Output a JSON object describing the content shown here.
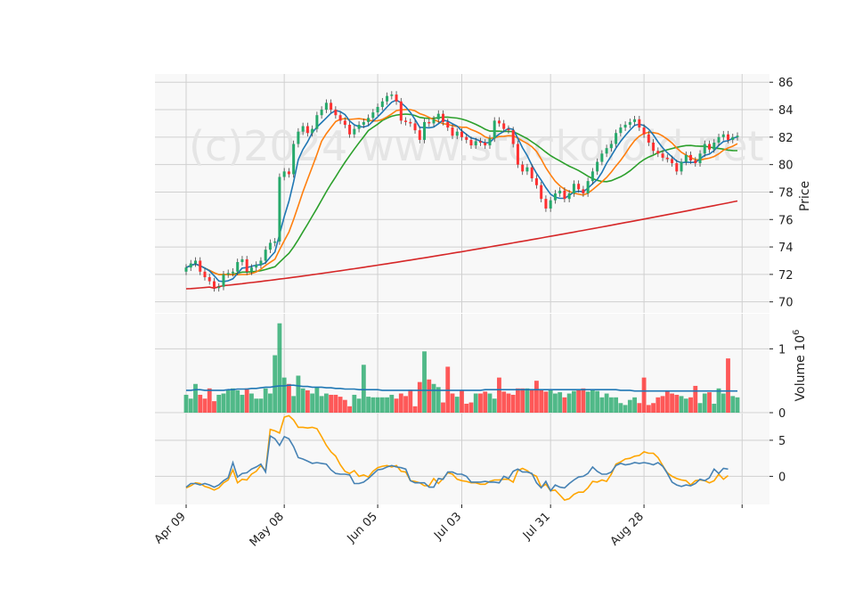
{
  "watermark": "(c)2024 www.stockdroid.net",
  "chart_data": [
    {
      "type": "candlestick",
      "panel": "price",
      "ylabel": "Price",
      "ylim": [
        69.2,
        86.6
      ],
      "yticks": [
        70,
        72,
        74,
        76,
        78,
        80,
        82,
        84,
        86
      ],
      "dates": [
        "2024-04-09",
        "2024-04-10",
        "2024-04-11",
        "2024-04-12",
        "2024-04-15",
        "2024-04-16",
        "2024-04-17",
        "2024-04-18",
        "2024-04-19",
        "2024-04-22",
        "2024-04-23",
        "2024-04-24",
        "2024-04-25",
        "2024-04-26",
        "2024-04-29",
        "2024-04-30",
        "2024-05-01",
        "2024-05-02",
        "2024-05-03",
        "2024-05-06",
        "2024-05-07",
        "2024-05-08",
        "2024-05-09",
        "2024-05-10",
        "2024-05-13",
        "2024-05-14",
        "2024-05-15",
        "2024-05-16",
        "2024-05-17",
        "2024-05-20",
        "2024-05-21",
        "2024-05-22",
        "2024-05-23",
        "2024-05-24",
        "2024-05-28",
        "2024-05-29",
        "2024-05-30",
        "2024-05-31",
        "2024-06-03",
        "2024-06-04",
        "2024-06-05",
        "2024-06-06",
        "2024-06-07",
        "2024-06-10",
        "2024-06-11",
        "2024-06-12",
        "2024-06-13",
        "2024-06-14",
        "2024-06-17",
        "2024-06-18",
        "2024-06-20",
        "2024-06-21",
        "2024-06-24",
        "2024-06-25",
        "2024-06-26",
        "2024-06-27",
        "2024-06-28",
        "2024-07-01",
        "2024-07-02",
        "2024-07-03",
        "2024-07-05",
        "2024-07-08",
        "2024-07-09",
        "2024-07-10",
        "2024-07-11",
        "2024-07-12",
        "2024-07-15",
        "2024-07-16",
        "2024-07-17",
        "2024-07-18",
        "2024-07-19",
        "2024-07-22",
        "2024-07-23",
        "2024-07-24",
        "2024-07-25",
        "2024-07-26",
        "2024-07-29",
        "2024-07-30",
        "2024-07-31",
        "2024-08-01",
        "2024-08-02",
        "2024-08-05",
        "2024-08-06",
        "2024-08-07",
        "2024-08-08",
        "2024-08-09",
        "2024-08-12",
        "2024-08-13",
        "2024-08-14",
        "2024-08-15",
        "2024-08-16",
        "2024-08-19",
        "2024-08-20",
        "2024-08-21",
        "2024-08-22",
        "2024-08-23",
        "2024-08-26",
        "2024-08-27",
        "2024-08-28",
        "2024-08-29",
        "2024-08-30",
        "2024-09-03",
        "2024-09-04",
        "2024-09-05",
        "2024-09-06",
        "2024-09-09",
        "2024-09-10",
        "2024-09-11",
        "2024-09-12",
        "2024-09-13",
        "2024-09-16",
        "2024-09-17",
        "2024-09-18",
        "2024-09-19",
        "2024-09-20",
        "2024-09-23",
        "2024-09-24",
        "2024-09-25",
        "2024-09-26"
      ],
      "close": [
        72.5,
        72.8,
        73.0,
        72.2,
        71.8,
        71.5,
        71.0,
        71.1,
        72.0,
        72.1,
        72.2,
        72.9,
        73.1,
        72.2,
        72.5,
        72.7,
        73.0,
        73.8,
        74.3,
        74.4,
        79.1,
        79.5,
        79.3,
        81.5,
        82.4,
        82.8,
        82.3,
        82.6,
        83.6,
        84.0,
        84.5,
        84.0,
        83.6,
        83.2,
        82.9,
        82.2,
        82.6,
        82.9,
        83.1,
        83.4,
        83.8,
        84.2,
        84.6,
        85.0,
        85.1,
        84.6,
        83.2,
        83.1,
        83.0,
        82.5,
        81.8,
        83.1,
        83.0,
        83.3,
        83.7,
        83.1,
        82.7,
        82.1,
        82.4,
        82.0,
        81.8,
        81.4,
        81.7,
        81.6,
        81.4,
        81.9,
        83.2,
        83.0,
        82.6,
        82.5,
        81.5,
        80.0,
        79.5,
        79.8,
        79.0,
        78.5,
        77.5,
        76.8,
        77.4,
        77.9,
        78.1,
        77.5,
        77.9,
        78.6,
        78.2,
        77.9,
        78.8,
        79.5,
        80.2,
        80.8,
        81.2,
        81.5,
        82.3,
        82.7,
        82.9,
        83.1,
        83.3,
        82.7,
        82.2,
        81.6,
        81.0,
        80.8,
        80.5,
        80.4,
        80.1,
        79.5,
        80.2,
        80.7,
        80.3,
        80.1,
        80.8,
        81.5,
        81.1,
        81.6,
        82.0,
        82.2,
        81.8,
        82.0,
        82.1
      ],
      "indicators": [
        "MA 5",
        "MA 10",
        "MA 20",
        "MA 100"
      ]
    },
    {
      "type": "bar",
      "panel": "volume",
      "ylabel": "Volume  10^6",
      "ylim": [
        0,
        1.55
      ],
      "yticks": [
        0,
        1
      ],
      "volume_millions": [
        0.28,
        0.22,
        0.45,
        0.28,
        0.22,
        0.38,
        0.18,
        0.28,
        0.3,
        0.35,
        0.38,
        0.35,
        0.28,
        0.38,
        0.3,
        0.22,
        0.22,
        0.38,
        0.3,
        0.9,
        1.4,
        0.55,
        0.45,
        0.26,
        0.58,
        0.38,
        0.35,
        0.3,
        0.4,
        0.26,
        0.3,
        0.28,
        0.28,
        0.25,
        0.2,
        0.1,
        0.28,
        0.22,
        0.75,
        0.25,
        0.24,
        0.24,
        0.24,
        0.24,
        0.28,
        0.22,
        0.3,
        0.26,
        0.36,
        0.1,
        0.48,
        0.96,
        0.52,
        0.45,
        0.4,
        0.16,
        0.72,
        0.3,
        0.25,
        0.35,
        0.14,
        0.16,
        0.3,
        0.3,
        0.33,
        0.3,
        0.22,
        0.55,
        0.33,
        0.3,
        0.28,
        0.38,
        0.38,
        0.38,
        0.35,
        0.5,
        0.36,
        0.33,
        0.36,
        0.3,
        0.32,
        0.24,
        0.3,
        0.34,
        0.36,
        0.38,
        0.33,
        0.36,
        0.34,
        0.24,
        0.3,
        0.24,
        0.24,
        0.15,
        0.12,
        0.2,
        0.24,
        0.15,
        0.55,
        0.12,
        0.15,
        0.24,
        0.26,
        0.34,
        0.3,
        0.28,
        0.26,
        0.22,
        0.24,
        0.42,
        0.15,
        0.3,
        0.32,
        0.14,
        0.38,
        0.3,
        0.85,
        0.26,
        0.24
      ],
      "volume_ma_millions": [
        0.35,
        0.35,
        0.36,
        0.36,
        0.35,
        0.35,
        0.35,
        0.35,
        0.35,
        0.36,
        0.36,
        0.37,
        0.37,
        0.37,
        0.38,
        0.38,
        0.39,
        0.4,
        0.4,
        0.41,
        0.42,
        0.42,
        0.43,
        0.43,
        0.42,
        0.41,
        0.41,
        0.4,
        0.4,
        0.4,
        0.39,
        0.39,
        0.38,
        0.38,
        0.37,
        0.37,
        0.37,
        0.36,
        0.36,
        0.36,
        0.36,
        0.36,
        0.35,
        0.35,
        0.35,
        0.35,
        0.35,
        0.35,
        0.35,
        0.35,
        0.35,
        0.35,
        0.35,
        0.35,
        0.35,
        0.35,
        0.35,
        0.35,
        0.35,
        0.35,
        0.35,
        0.35,
        0.35,
        0.35,
        0.36,
        0.36,
        0.36,
        0.36,
        0.36,
        0.36,
        0.36,
        0.36,
        0.36,
        0.36,
        0.36,
        0.36,
        0.36,
        0.36,
        0.36,
        0.36,
        0.36,
        0.36,
        0.36,
        0.36,
        0.36,
        0.36,
        0.36,
        0.36,
        0.36,
        0.36,
        0.36,
        0.36,
        0.36,
        0.35,
        0.35,
        0.35,
        0.34,
        0.34,
        0.34,
        0.34,
        0.34,
        0.34,
        0.34,
        0.34,
        0.34,
        0.34,
        0.34,
        0.34,
        0.34,
        0.34,
        0.34,
        0.34,
        0.34,
        0.34,
        0.34,
        0.34,
        0.34,
        0.34,
        0.34
      ]
    },
    {
      "type": "line",
      "panel": "oscillator",
      "yticks": [
        0,
        5
      ],
      "ylim": [
        -3.9,
        8.7
      ],
      "series": [
        {
          "values": [
            -1.5,
            -1.0,
            -1.0,
            -1.2,
            -1.0,
            -1.2,
            -1.5,
            -1.2,
            -0.6,
            -0.2,
            1.9,
            -0.1,
            0.4,
            0.5,
            1.0,
            1.3,
            1.7,
            0.6,
            5.6,
            5.2,
            4.3,
            5.5,
            5.2,
            4.1,
            2.6,
            2.4,
            2.1,
            1.8,
            1.9,
            1.8,
            1.7,
            0.9,
            0.4,
            0.3,
            0.3,
            0.2,
            -1.0,
            -1.0,
            -0.8,
            -0.3,
            0.3,
            0.9,
            1.0,
            1.3,
            1.5,
            1.3,
            1.2,
            1.0,
            -0.6,
            -0.9,
            -0.9,
            -0.9,
            -1.5,
            -1.5,
            -0.3,
            -0.4,
            0.6,
            0.6,
            0.3,
            0.3,
            0.0,
            -0.8,
            -0.8,
            -0.8,
            -0.7,
            -0.8,
            -0.8,
            -0.9,
            0.0,
            -0.3,
            0.7,
            1.0,
            0.6,
            0.6,
            0.4,
            -0.9,
            -1.6,
            -0.7,
            -2.0,
            -1.2,
            -1.5,
            -1.6,
            -1.0,
            -0.5,
            -0.1,
            0.0,
            0.4,
            1.3,
            0.7,
            0.3,
            0.3,
            0.6,
            1.5,
            1.8,
            1.6,
            1.7,
            1.9,
            1.8,
            1.9,
            1.8,
            1.6,
            1.9,
            1.4,
            0.4,
            -0.8,
            -1.2,
            -1.4,
            -1.2,
            -1.3,
            -1.0,
            -0.4,
            -0.6,
            -0.2,
            1.0,
            0.4,
            1.1,
            1.0
          ]
        },
        {
          "values": [
            -1.6,
            -1.3,
            -0.9,
            -1.0,
            -1.4,
            -1.6,
            -1.9,
            -1.6,
            -0.9,
            -0.5,
            0.9,
            -0.9,
            -0.4,
            -0.5,
            0.3,
            0.7,
            1.5,
            0.8,
            6.5,
            6.3,
            6.0,
            8.2,
            8.4,
            7.8,
            6.8,
            6.8,
            6.7,
            6.8,
            6.6,
            5.5,
            4.3,
            3.4,
            2.8,
            1.6,
            0.7,
            0.4,
            0.8,
            0.0,
            0.2,
            -0.1,
            0.7,
            1.2,
            1.4,
            1.5,
            1.3,
            1.5,
            0.7,
            0.6,
            -0.6,
            -0.7,
            -0.9,
            -1.3,
            -1.3,
            -0.3,
            -1.0,
            -0.3,
            0.5,
            0.3,
            -0.4,
            -0.6,
            -0.7,
            -0.9,
            -0.9,
            -1.1,
            -1.1,
            -0.7,
            -0.5,
            -0.5,
            -0.4,
            -0.4,
            -0.8,
            0.8,
            1.1,
            0.8,
            0.3,
            0.0,
            -1.5,
            -1.1,
            -2.0,
            -1.9,
            -2.6,
            -3.3,
            -3.1,
            -2.5,
            -2.2,
            -2.2,
            -1.6,
            -0.7,
            -0.8,
            -0.5,
            -0.7,
            0.3,
            1.7,
            2.0,
            2.4,
            2.5,
            2.8,
            2.9,
            3.4,
            3.2,
            3.2,
            2.6,
            1.5,
            0.5,
            0.0,
            -0.3,
            -0.5,
            -0.6,
            -1.2,
            -0.6,
            -0.5,
            -0.6,
            -0.9,
            -0.6,
            0.3,
            -0.4,
            0.1
          ]
        }
      ]
    }
  ],
  "x_axis": {
    "tick_labels": [
      {
        "label": "Apr 09",
        "index": 0
      },
      {
        "label": "May 08",
        "index": 21
      },
      {
        "label": "Jun 05",
        "index": 41
      },
      {
        "label": "Jul 03",
        "index": 59
      },
      {
        "label": "Jul 31",
        "index": 78
      },
      {
        "label": "Aug 28",
        "index": 98
      }
    ],
    "extra_tick_index": 119
  },
  "colors": {
    "up": "#26a96b",
    "down": "#ff3030",
    "wick": "#444444",
    "ma5": "#1f77b4",
    "ma10": "#ff7f0e",
    "ma20": "#2ca02c",
    "ma100": "#d62728",
    "volume_ma": "#1f77b4",
    "osc_1": "#4682b4",
    "osc_2": "#ffa500",
    "panel_bg": "#f8f8f8",
    "grid": "#d0d0d0",
    "watermark": "#e5e5e5"
  }
}
